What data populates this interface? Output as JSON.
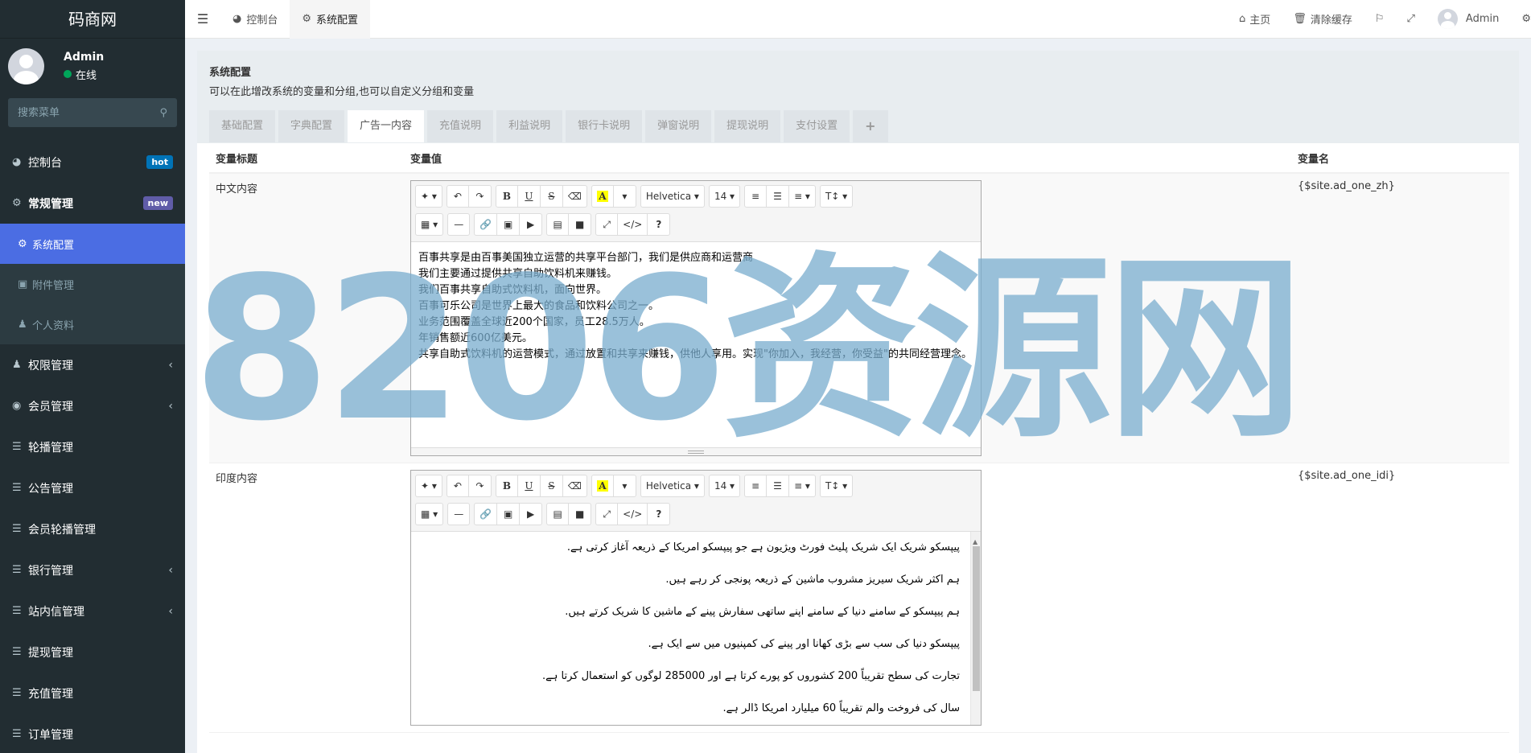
{
  "brand": "码商网",
  "user": {
    "name": "Admin",
    "status": "在线"
  },
  "sidebar": {
    "search_placeholder": "搜索菜单",
    "items": [
      {
        "label": "控制台",
        "badge": "hot"
      },
      {
        "label": "常规管理",
        "badge": "new"
      },
      {
        "label": "系统配置"
      },
      {
        "label": "附件管理"
      },
      {
        "label": "个人资料"
      },
      {
        "label": "权限管理"
      },
      {
        "label": "会员管理"
      },
      {
        "label": "轮播管理"
      },
      {
        "label": "公告管理"
      },
      {
        "label": "会员轮播管理"
      },
      {
        "label": "银行管理"
      },
      {
        "label": "站内信管理"
      },
      {
        "label": "提现管理"
      },
      {
        "label": "充值管理"
      },
      {
        "label": "订单管理"
      }
    ]
  },
  "topbar": {
    "tabs": [
      "控制台",
      "系统配置"
    ],
    "home": "主页",
    "clear_cache": "清除缓存",
    "admin": "Admin"
  },
  "panel": {
    "title": "系统配置",
    "subtitle": "可以在此增改系统的变量和分组,也可以自定义分组和变量",
    "tabs": [
      "基础配置",
      "字典配置",
      "广告一内容",
      "充值说明",
      "利益说明",
      "银行卡说明",
      "弹窗说明",
      "提现说明",
      "支付设置",
      "+"
    ]
  },
  "table": {
    "headers": [
      "变量标题",
      "变量值",
      "变量名"
    ],
    "rows": [
      {
        "title": "中文内容",
        "varname": "{$site.ad_one_zh}",
        "lines": [
          "百事共享是由百事美国独立运营的共享平台部门，我们是供应商和运营商",
          "我们主要通过提供共享自助饮料机来赚钱。",
          "我们百事共享自助式饮料机，面向世界。",
          "百事可乐公司是世界上最大的食品和饮料公司之一。",
          "业务范围覆盖全球近200个国家，员工28.5万人。",
          "年销售额近600亿美元。",
          "共享自助式饮料机的运营模式，通过放置和共享来赚钱，供他人享用。实现\"你加入，我经营，你受益\"的共同经营理念。"
        ]
      },
      {
        "title": "印度内容",
        "varname": "{$site.ad_one_idi}",
        "lines": [
          "پیپسکو شریک ایک شریک پلیٹ فورٹ ویژیون ہے جو پیپسکو امریکا کے ذریعہ آغاز کرتی ہے.",
          "ہم اکثر شریک سیریز مشروب ماشین کے ذریعہ پونجی کر رہے ہیں.",
          "ہم پیپسکو کے سامنے دنیا کے سامنے اپنے ساتھی سفارش پینے کے ماشین کا شریک کرتے ہیں.",
          "پیپسکو دنیا کی سب سے بڑی کھانا اور پینے کی کمپنیوں میں سے ایک ہے.",
          "تجارت کی سطح تقریباً 200 کشوروں کو پورے کرتا ہے اور 285000 لوگوں کو استعمال کرتا ہے.",
          "سال کی فروخت والم تقریباً 60 میلیارد امریکا ڈالر ہے."
        ]
      }
    ]
  },
  "editor": {
    "font_name": "Helvetica",
    "font_size": "14",
    "color_icon": "A"
  },
  "watermark": "8206资源网"
}
